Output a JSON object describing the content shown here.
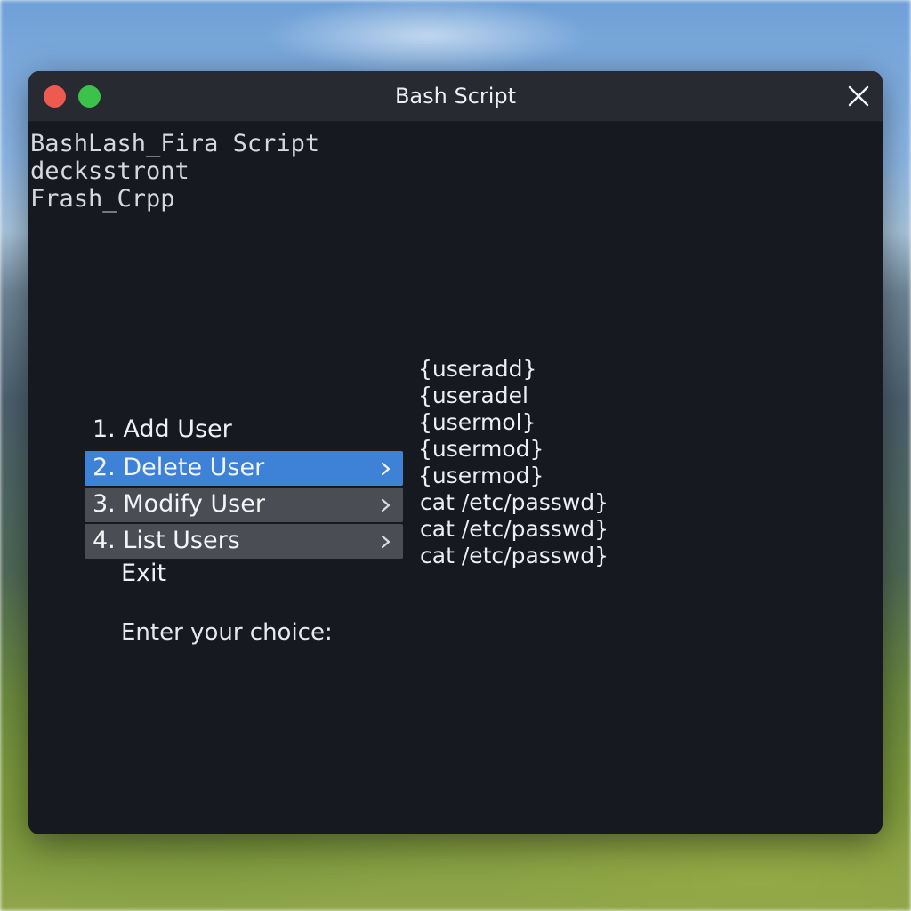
{
  "window": {
    "title": "Bash Script",
    "close_icon": "close-icon",
    "traffic_lights": [
      "red",
      "green"
    ]
  },
  "terminal": {
    "header_lines": [
      "BashLash_Fira Script",
      "decksstront",
      "Frash_Crpp"
    ],
    "menu": {
      "add_user": "1. Add User",
      "items": [
        {
          "label": "2. Delete User",
          "selected": true
        },
        {
          "label": "3. Modify User",
          "selected": false
        },
        {
          "label": "4. List Users",
          "selected": false
        }
      ],
      "exit": "Exit"
    },
    "commands": [
      "{useradd}",
      "{useradel",
      "{usermol}",
      "{usermod}",
      "{usermod}",
      "cat /etc/passwd}",
      "cat /etc/passwd}",
      "cat /etc/passwd}"
    ],
    "prompt": "Enter your choice:"
  },
  "colors": {
    "terminal_bg": "#161920",
    "titlebar_bg": "#272a31",
    "selected_bg": "#3d82d6",
    "menu_bg": "#4a4d53",
    "traffic_red": "#ec5a50",
    "traffic_green": "#3cc24a"
  }
}
